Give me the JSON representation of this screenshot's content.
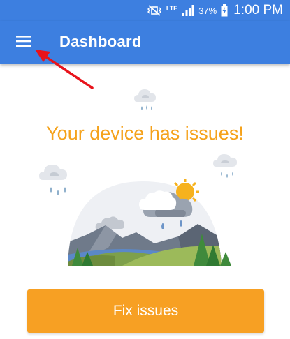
{
  "status_bar": {
    "network_type": "LTE",
    "battery_percent": "37%",
    "time": "1:00 PM"
  },
  "app_bar": {
    "title": "Dashboard",
    "menu_icon": "hamburger-menu-icon"
  },
  "main": {
    "headline": "Your device has issues!",
    "illustration": "weather-landscape-illustration",
    "primary_button_label": "Fix issues"
  },
  "colors": {
    "app_bar": "#3d7fe0",
    "headline": "#f5a21b",
    "button": "#f7a023",
    "annotation_arrow": "#e8131b"
  }
}
